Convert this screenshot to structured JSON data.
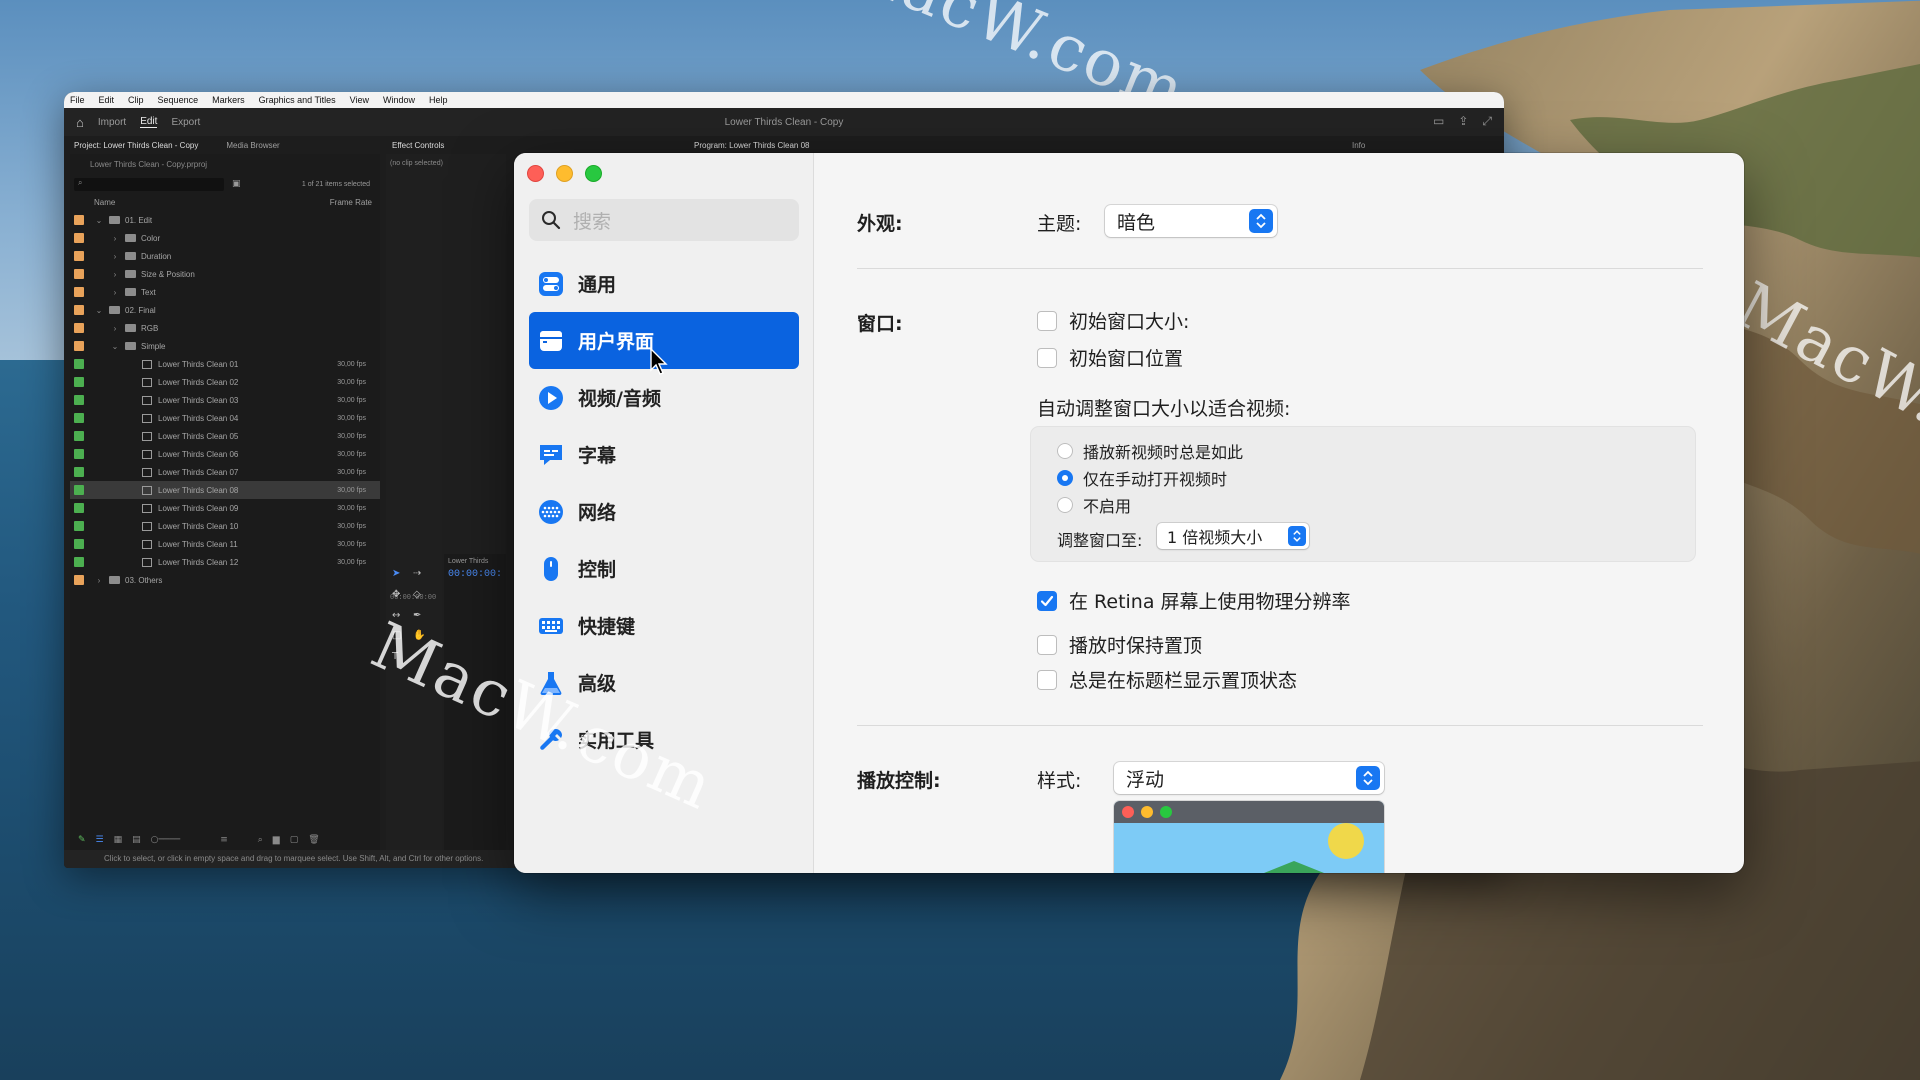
{
  "desktop": {
    "watermarks": [
      "MacW.com",
      "MacW.com",
      "MacW.com"
    ]
  },
  "premiere": {
    "menu": [
      "File",
      "Edit",
      "Clip",
      "Sequence",
      "Markers",
      "Graphics and Titles",
      "View",
      "Window",
      "Help"
    ],
    "tabs": [
      "Import",
      "Edit",
      "Export"
    ],
    "doc_title": "Lower Thirds Clean - Copy",
    "project_tab": "Project: Lower Thirds Clean - Copy",
    "media_browser_tab": "Media Browser",
    "effect_controls_tab": "Effect Controls",
    "program_tab": "Program: Lower Thirds Clean 08",
    "info_tab": "Info",
    "project_file": "Lower Thirds Clean - Copy.prproj",
    "items_selected": "1 of 21 items selected",
    "col_name": "Name",
    "col_frame_rate": "Frame Rate",
    "no_clip": "(no clip selected)",
    "effects_tc": "00:00:00:00",
    "timeline_title": "Lower Thirds",
    "timeline_tc": "00:00:00:",
    "status_text": "Click to select, or click in empty space and drag to marquee select. Use Shift, Alt, and Ctrl for other options.",
    "rows": [
      {
        "name": "01. Edit",
        "indent": 0,
        "kind": "folder",
        "open": true,
        "color": "#e8a25a",
        "fps": ""
      },
      {
        "name": "Color",
        "indent": 1,
        "kind": "folder",
        "open": false,
        "color": "#e8a25a",
        "fps": ""
      },
      {
        "name": "Duration",
        "indent": 1,
        "kind": "folder",
        "open": false,
        "color": "#e8a25a",
        "fps": ""
      },
      {
        "name": "Size & Position",
        "indent": 1,
        "kind": "folder",
        "open": false,
        "color": "#e8a25a",
        "fps": ""
      },
      {
        "name": "Text",
        "indent": 1,
        "kind": "folder",
        "open": false,
        "color": "#e8a25a",
        "fps": ""
      },
      {
        "name": "02. Final",
        "indent": 0,
        "kind": "folder",
        "open": true,
        "color": "#e8a25a",
        "fps": ""
      },
      {
        "name": "RGB",
        "indent": 1,
        "kind": "folder",
        "open": false,
        "color": "#e8a25a",
        "fps": ""
      },
      {
        "name": "Simple",
        "indent": 1,
        "kind": "folder",
        "open": true,
        "color": "#e8a25a",
        "fps": ""
      },
      {
        "name": "Lower Thirds Clean 01",
        "indent": 2,
        "kind": "seq",
        "color": "#4caf50",
        "fps": "30,00 fps"
      },
      {
        "name": "Lower Thirds Clean 02",
        "indent": 2,
        "kind": "seq",
        "color": "#4caf50",
        "fps": "30,00 fps"
      },
      {
        "name": "Lower Thirds Clean 03",
        "indent": 2,
        "kind": "seq",
        "color": "#4caf50",
        "fps": "30,00 fps"
      },
      {
        "name": "Lower Thirds Clean 04",
        "indent": 2,
        "kind": "seq",
        "color": "#4caf50",
        "fps": "30,00 fps"
      },
      {
        "name": "Lower Thirds Clean 05",
        "indent": 2,
        "kind": "seq",
        "color": "#4caf50",
        "fps": "30,00 fps"
      },
      {
        "name": "Lower Thirds Clean 06",
        "indent": 2,
        "kind": "seq",
        "color": "#4caf50",
        "fps": "30,00 fps"
      },
      {
        "name": "Lower Thirds Clean 07",
        "indent": 2,
        "kind": "seq",
        "color": "#4caf50",
        "fps": "30,00 fps"
      },
      {
        "name": "Lower Thirds Clean 08",
        "indent": 2,
        "kind": "seq",
        "color": "#4caf50",
        "fps": "30,00 fps",
        "selected": true
      },
      {
        "name": "Lower Thirds Clean 09",
        "indent": 2,
        "kind": "seq",
        "color": "#4caf50",
        "fps": "30,00 fps"
      },
      {
        "name": "Lower Thirds Clean 10",
        "indent": 2,
        "kind": "seq",
        "color": "#4caf50",
        "fps": "30,00 fps"
      },
      {
        "name": "Lower Thirds Clean 11",
        "indent": 2,
        "kind": "seq",
        "color": "#4caf50",
        "fps": "30,00 fps"
      },
      {
        "name": "Lower Thirds Clean 12",
        "indent": 2,
        "kind": "seq",
        "color": "#4caf50",
        "fps": "30,00 fps"
      },
      {
        "name": "03. Others",
        "indent": 0,
        "kind": "folder",
        "open": false,
        "color": "#e8a25a",
        "fps": ""
      }
    ]
  },
  "prefs": {
    "search_placeholder": "搜索",
    "nav": [
      {
        "label": "通用",
        "icon": "toggle-switches-icon",
        "active": false
      },
      {
        "label": "用户界面",
        "icon": "window-icon",
        "active": true
      },
      {
        "label": "视频/音频",
        "icon": "play-circle-icon",
        "active": false
      },
      {
        "label": "字幕",
        "icon": "speech-bubble-icon",
        "active": false
      },
      {
        "label": "网络",
        "icon": "globe-icon",
        "active": false
      },
      {
        "label": "控制",
        "icon": "mouse-icon",
        "active": false
      },
      {
        "label": "快捷键",
        "icon": "keyboard-icon",
        "active": false
      },
      {
        "label": "高级",
        "icon": "flask-icon",
        "active": false
      },
      {
        "label": "实用工具",
        "icon": "wrench-icon",
        "active": false
      }
    ],
    "appearance": {
      "section": "外观:",
      "theme_label": "主题:",
      "theme_value": "暗色"
    },
    "window": {
      "section": "窗口:",
      "initial_size": {
        "label": "初始窗口大小:",
        "checked": false
      },
      "initial_position": {
        "label": "初始窗口位置",
        "checked": false
      },
      "auto_resize_label": "自动调整窗口大小以适合视频:",
      "radio_options": [
        {
          "label": "播放新视频时总是如此",
          "checked": false
        },
        {
          "label": "仅在手动打开视频时",
          "checked": true
        },
        {
          "label": "不启用",
          "checked": false
        }
      ],
      "resize_to_label": "调整窗口至:",
      "resize_to_value": "1 倍视频大小",
      "retina": {
        "label": "在 Retina 屏幕上使用物理分辨率",
        "checked": true
      },
      "keep_on_top": {
        "label": "播放时保持置顶",
        "checked": false
      },
      "show_top_state": {
        "label": "总是在标题栏显示置顶状态",
        "checked": false
      }
    },
    "playback": {
      "section": "播放控制:",
      "style_label": "样式:",
      "style_value": "浮动"
    },
    "colors": {
      "accent": "#1877f2",
      "sidebar_selected": "#0a63e0"
    }
  }
}
